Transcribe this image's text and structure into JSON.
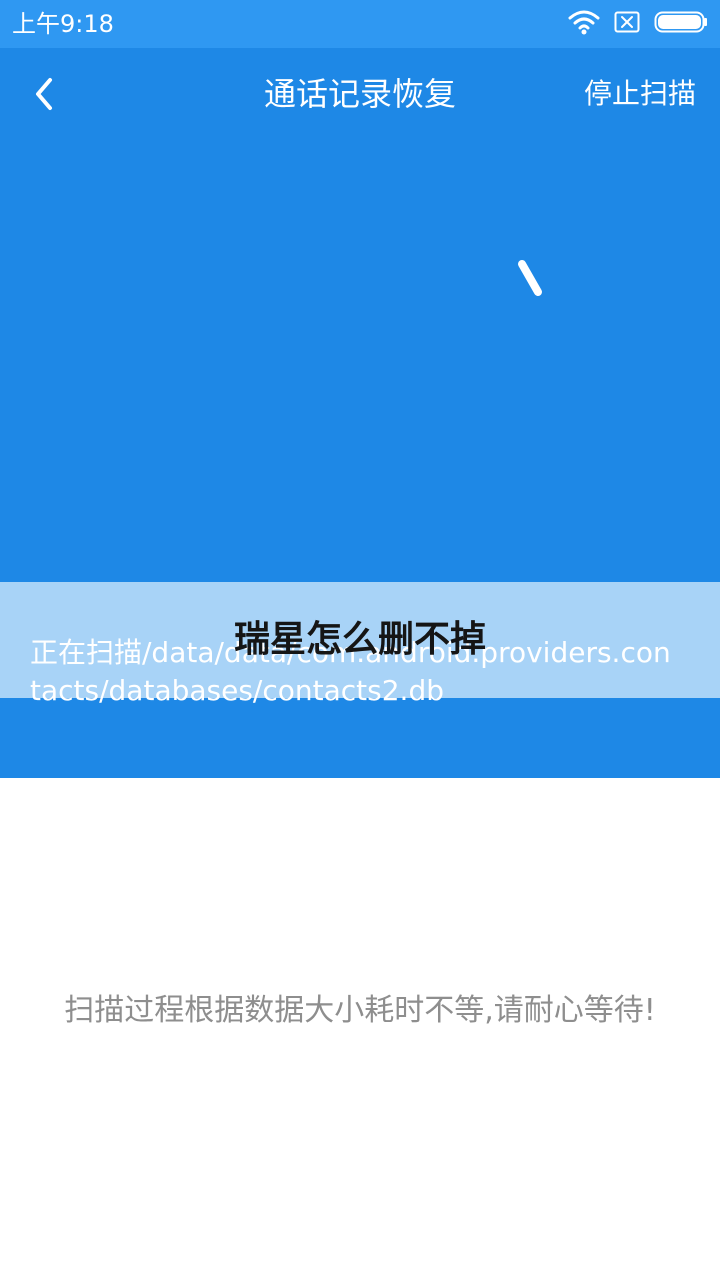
{
  "status_bar": {
    "time": "上午9:18",
    "icons": [
      "wifi-icon",
      "sim-off-icon",
      "battery-icon"
    ]
  },
  "header": {
    "title": "通话记录恢复",
    "stop_label": "停止扫描",
    "back_icon": "chevron-left-icon"
  },
  "overlay": {
    "title": "瑞星怎么删不掉"
  },
  "scan": {
    "path": "正在扫描/data/data/com.android.providers.contacts/databases/contacts2.db",
    "hint": "扫描过程根据数据大小耗时不等,请耐心等待!"
  },
  "colors": {
    "primary": "#1e88e6",
    "status_bar": "#2f98f2",
    "overlay": "#a8d3f7",
    "hint_text": "#8e8e8e"
  }
}
